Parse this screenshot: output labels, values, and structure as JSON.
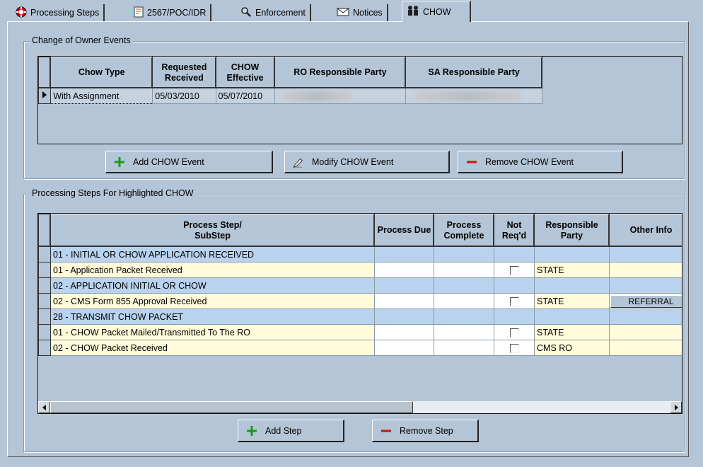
{
  "tabs": [
    {
      "label": "Processing Steps",
      "icon": "lifebuoy-icon"
    },
    {
      "label": "2567/POC/IDR",
      "icon": "form-icon"
    },
    {
      "label": "Enforcement",
      "icon": "magnifier-icon"
    },
    {
      "label": "Notices",
      "icon": "envelope-icon"
    },
    {
      "label": "CHOW",
      "icon": "people-icon"
    }
  ],
  "chow_group": {
    "title": "Change of Owner Events",
    "columns": [
      "Chow Type",
      "Requested Received",
      "CHOW Effective",
      "RO Responsible Party",
      "SA Responsible Party"
    ],
    "rows": [
      {
        "type": "With Assignment",
        "requested": "05/03/2010",
        "effective": "05/07/2010",
        "ro": "",
        "sa": ""
      }
    ],
    "buttons": {
      "add": "Add CHOW Event",
      "modify": "Modify CHOW Event",
      "remove": "Remove CHOW Event"
    }
  },
  "steps_group": {
    "title": "Processing Steps For Highlighted CHOW",
    "columns": [
      "Process Step/\nSubStep",
      "Process Due",
      "Process Complete",
      "Not Req'd",
      "Responsible Party",
      "Other Info"
    ],
    "rows": [
      {
        "step": "01 - INITIAL OR CHOW APPLICATION RECEIVED",
        "kind": "header",
        "party": "",
        "other": ""
      },
      {
        "step": "01 - Application Packet Received",
        "kind": "sub",
        "party": "STATE",
        "other": ""
      },
      {
        "step": "02 - APPLICATION INITIAL OR CHOW",
        "kind": "header",
        "party": "",
        "other": ""
      },
      {
        "step": "02 - CMS Form 855 Approval Received",
        "kind": "sub",
        "party": "STATE",
        "other": "REFERRAL"
      },
      {
        "step": "28 - TRANSMIT CHOW PACKET",
        "kind": "header",
        "party": "",
        "other": ""
      },
      {
        "step": "01 - CHOW Packet Mailed/Transmitted To The RO",
        "kind": "sub",
        "party": "STATE",
        "other": ""
      },
      {
        "step": "02 - CHOW Packet Received",
        "kind": "sub",
        "party": "CMS RO",
        "other": ""
      }
    ],
    "buttons": {
      "add": "Add Step",
      "remove": "Remove Step"
    }
  },
  "colors": {
    "accent_green": "#1a9a1a",
    "accent_red": "#d01010",
    "row_blue": "#b9d3ef",
    "row_yellow": "#fffbdb"
  }
}
